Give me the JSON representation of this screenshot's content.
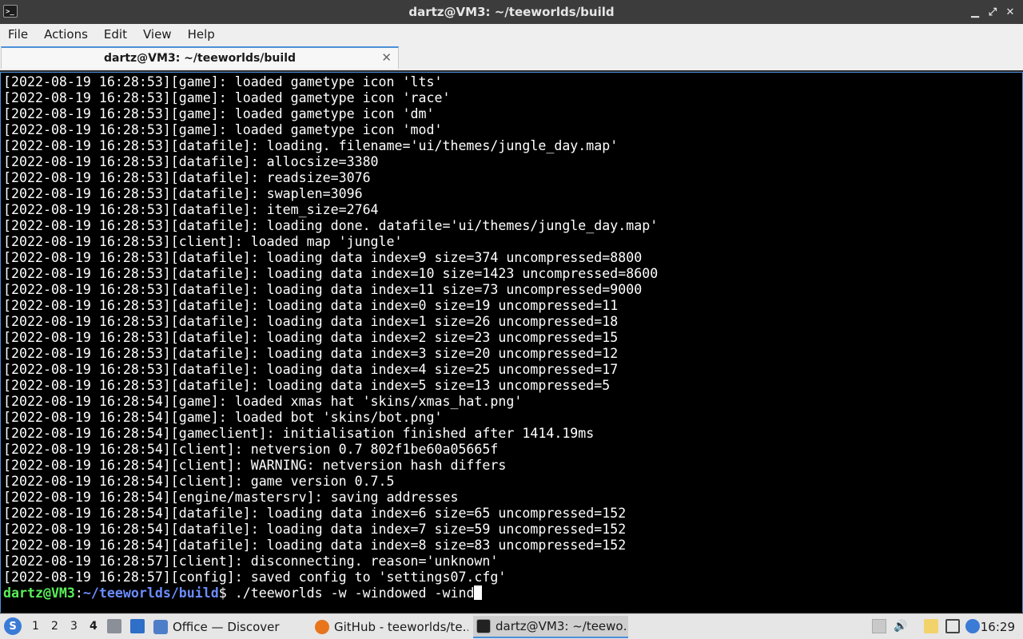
{
  "window": {
    "title": "dartz@VM3: ~/teeworlds/build",
    "app_icon": ">_",
    "btn_min": "▁",
    "btn_max": "⤢",
    "btn_close": "✕"
  },
  "menu": [
    "File",
    "Actions",
    "Edit",
    "View",
    "Help"
  ],
  "tab": {
    "label": "dartz@VM3: ~/teeworlds/build",
    "close": "✕"
  },
  "terminal": {
    "lines": [
      "[2022-08-19 16:28:53][game]: loaded gametype icon 'lts'",
      "[2022-08-19 16:28:53][game]: loaded gametype icon 'race'",
      "[2022-08-19 16:28:53][game]: loaded gametype icon 'dm'",
      "[2022-08-19 16:28:53][game]: loaded gametype icon 'mod'",
      "[2022-08-19 16:28:53][datafile]: loading. filename='ui/themes/jungle_day.map'",
      "[2022-08-19 16:28:53][datafile]: allocsize=3380",
      "[2022-08-19 16:28:53][datafile]: readsize=3076",
      "[2022-08-19 16:28:53][datafile]: swaplen=3096",
      "[2022-08-19 16:28:53][datafile]: item_size=2764",
      "[2022-08-19 16:28:53][datafile]: loading done. datafile='ui/themes/jungle_day.map'",
      "[2022-08-19 16:28:53][client]: loaded map 'jungle'",
      "[2022-08-19 16:28:53][datafile]: loading data index=9 size=374 uncompressed=8800",
      "[2022-08-19 16:28:53][datafile]: loading data index=10 size=1423 uncompressed=8600",
      "[2022-08-19 16:28:53][datafile]: loading data index=11 size=73 uncompressed=9000",
      "[2022-08-19 16:28:53][datafile]: loading data index=0 size=19 uncompressed=11",
      "[2022-08-19 16:28:53][datafile]: loading data index=1 size=26 uncompressed=18",
      "[2022-08-19 16:28:53][datafile]: loading data index=2 size=23 uncompressed=15",
      "[2022-08-19 16:28:53][datafile]: loading data index=3 size=20 uncompressed=12",
      "[2022-08-19 16:28:53][datafile]: loading data index=4 size=25 uncompressed=17",
      "[2022-08-19 16:28:53][datafile]: loading data index=5 size=13 uncompressed=5",
      "[2022-08-19 16:28:54][game]: loaded xmas hat 'skins/xmas_hat.png'",
      "[2022-08-19 16:28:54][game]: loaded bot 'skins/bot.png'",
      "[2022-08-19 16:28:54][gameclient]: initialisation finished after 1414.19ms",
      "[2022-08-19 16:28:54][client]: netversion 0.7 802f1be60a05665f",
      "[2022-08-19 16:28:54][client]: WARNING: netversion hash differs",
      "[2022-08-19 16:28:54][client]: game version 0.7.5",
      "[2022-08-19 16:28:54][engine/mastersrv]: saving addresses",
      "[2022-08-19 16:28:54][datafile]: loading data index=6 size=65 uncompressed=152",
      "[2022-08-19 16:28:54][datafile]: loading data index=7 size=59 uncompressed=152",
      "[2022-08-19 16:28:54][datafile]: loading data index=8 size=83 uncompressed=152",
      "[2022-08-19 16:28:57][client]: disconnecting. reason='unknown'",
      "[2022-08-19 16:28:57][config]: saved config to 'settings07.cfg'"
    ],
    "prompt_user": "dartz@VM3",
    "prompt_sep": ":",
    "prompt_path": "~/teeworlds/build",
    "prompt_symbol": "$",
    "command": " ./teeworlds -w -windowed -wind"
  },
  "taskbar": {
    "start_icon": "S",
    "workspaces": [
      "1",
      "2",
      "3",
      "4"
    ],
    "tasks": [
      {
        "label": "Office — Discover"
      },
      {
        "label": "GitHub - teeworlds/te…"
      },
      {
        "label": "dartz@VM3: ~/teewo…"
      }
    ],
    "tray": {
      "volume": "🔊",
      "clock": "16:29"
    },
    "colors": {
      "accent": "#4a90d9",
      "prompt_user": "#5af05a",
      "prompt_path": "#6c8cff"
    }
  }
}
